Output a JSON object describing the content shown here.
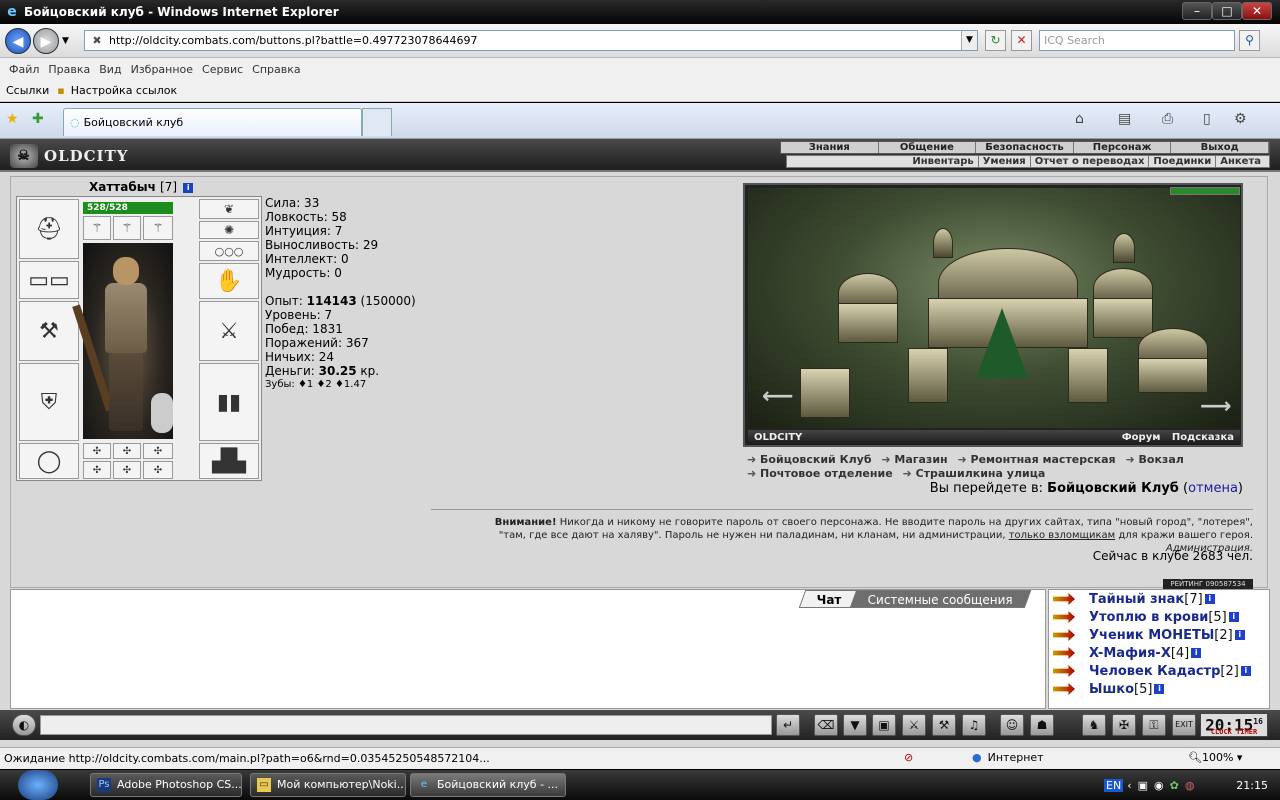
{
  "window": {
    "title": "Бойцовский клуб - Windows Internet Explorer",
    "min": "–",
    "max": "□",
    "close": "✕"
  },
  "address": {
    "url": "http://oldcity.combats.com/buttons.pl?battle=0.497723078644697",
    "search_placeholder": "ICQ Search"
  },
  "menu": [
    "Файл",
    "Правка",
    "Вид",
    "Избранное",
    "Сервис",
    "Справка"
  ],
  "links": {
    "label": "Ссылки",
    "item": "Настройка ссылок"
  },
  "tab": {
    "title": "Бойцовский клуб"
  },
  "game": {
    "logo": "OLDCITY",
    "topmenu": [
      "Знания",
      "Общение",
      "Безопасность",
      "Персонаж",
      "Выход"
    ],
    "submenu": [
      "Инвентарь",
      "Умения",
      "Отчет о переводах",
      "Поединки",
      "Анкета"
    ],
    "character": {
      "name": "Хаттабыч",
      "level": "[7]",
      "hp": "528/528"
    },
    "stats": {
      "sila": "Сила: 33",
      "lovkost": "Ловкость: 58",
      "intuition": "Интуиция: 7",
      "endurance": "Выносливость: 29",
      "intellect": "Интеллект: 0",
      "wisdom": "Мудрость: 0",
      "exp_label": "Опыт: ",
      "exp_value": "114143",
      "exp_next": " (150000)",
      "level": "Уровень: 7",
      "wins": "Побед: 1831",
      "losses": "Поражений: 367",
      "draws": "Ничьих: 24",
      "money_label": "Деньги: ",
      "money_value": "30.25",
      "money_unit": " кр.",
      "teeth": "Зубы: ♦1 ♦2 ♦1.47"
    },
    "city": {
      "name": "OLDCITY",
      "forum": "Форум",
      "hint": "Подсказка",
      "links": [
        "Бойцовский Клуб",
        "Магазин",
        "Ремонтная мастерская",
        "Вокзал",
        "Почтовое отделение",
        "Страшилкина улица"
      ],
      "goto_prefix": "Вы перейдете в: ",
      "goto_target": "Бойцовский Клуб",
      "goto_cancel": "отмена"
    },
    "warning": {
      "bold": "Внимание!",
      "text1": " Никогда и никому не говорите пароль от своего персонажа. Не вводите пароль на других сайтах, типа \"новый город\", \"лотерея\",",
      "text2": "\"там, где все дают на халяву\". Пароль не нужен ни паладинам, ни кланам, ни администрации, ",
      "link": "только взломщикам",
      "text3": " для кражи вашего героя.",
      "sign": "Администрация."
    },
    "online": "Сейчас в клубе 2683 чел.",
    "counter": "РЕЙТИНГ 090587534",
    "chat_tabs": [
      "Чат",
      "Системные сообщения"
    ],
    "users": [
      {
        "name": "Тайный знак",
        "level": "[7]"
      },
      {
        "name": "Утоплю в крови",
        "level": "[5]"
      },
      {
        "name": "Ученик МОНЕТЫ",
        "level": "[2]"
      },
      {
        "name": "X-Мафия-X",
        "level": "[4]"
      },
      {
        "name": "Человек Кадастр",
        "level": "[2]"
      },
      {
        "name": "Ышко",
        "level": "[5]"
      }
    ],
    "clock": {
      "time": "20:15",
      "sec": "16",
      "label": "CLOCK TIMER",
      "exit": "EXIT"
    }
  },
  "status": {
    "text": "Ожидание http://oldcity.combats.com/main.pl?path=o6&rnd=0.03545250548572104...",
    "zone": "Интернет",
    "zoom": "100%"
  },
  "taskbar": {
    "items": [
      "Adobe Photoshop CS...",
      "Мой компьютер\\Noki...",
      "Бойцовский клуб - ..."
    ],
    "lang": "EN",
    "time": "21:15"
  }
}
